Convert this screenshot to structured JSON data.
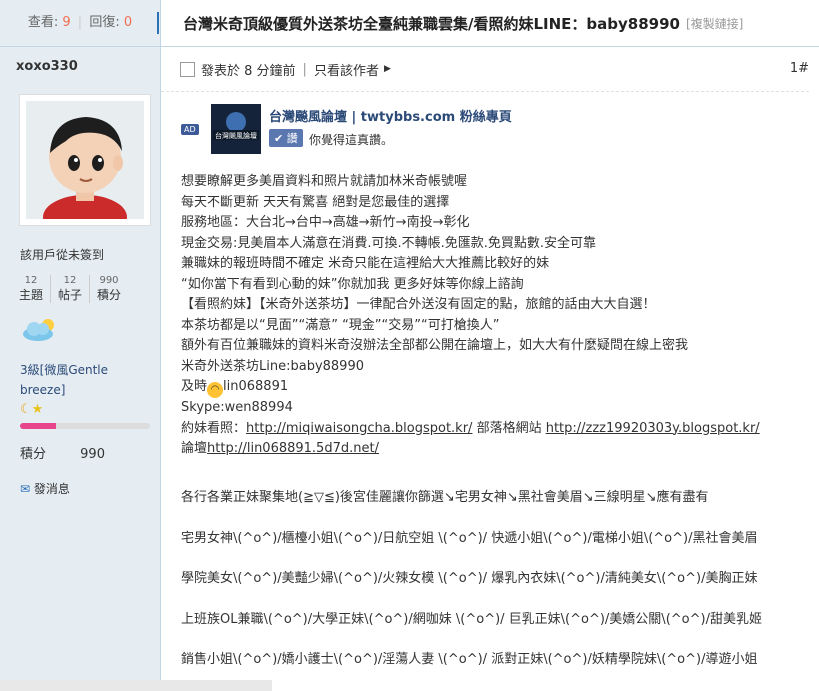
{
  "stats": {
    "views_label": "查看:",
    "views": "9",
    "replies_label": "回復:",
    "replies": "0"
  },
  "user": {
    "name": "xoxo330",
    "signin": "該用戶從未簽到",
    "counts": [
      {
        "value": "12",
        "label": "主題"
      },
      {
        "value": "12",
        "label": "帖子"
      },
      {
        "value": "990",
        "label": "積分"
      }
    ],
    "level": "3級[微風Gentle breeze]",
    "progress": 0.28,
    "score_label": "積分",
    "score": "990",
    "message": "發消息"
  },
  "thread": {
    "title": "台灣米奇頂級優質外送茶坊全臺純兼職雲集/看照約妹LINE：baby88990",
    "copy_link": "[複製鏈接]"
  },
  "post": {
    "posted": "發表於 8 分鐘前",
    "only_author": "只看該作者",
    "floor": "1#"
  },
  "fanpage": {
    "ad": "AD",
    "logo_text": "台灣飈風論壇",
    "name": "台灣飈風論壇 | twtybbs.com 粉絲專頁",
    "like": "讚",
    "text": "你覺得這真讚。"
  },
  "content": {
    "lines": [
      "想要瞭解更多美眉資料和照片就請加林米奇帳號喔",
      "每天不斷更新 天天有驚喜 絕對是您最佳的選擇",
      "服務地區：大台北→台中→高雄→新竹→南投→彰化",
      "現金交易:見美眉本人滿意在消費.可換.不轉帳.免匯款.免買點數.安全可靠",
      "兼職妹的報班時間不確定 米奇只能在這裡給大大推薦比較好的妹",
      "“如你當下有看到心動的妹”你就加我 更多好妹等你線上諮詢",
      "【看照約妹】【米奇外送茶坊】一律配合外送沒有固定的點，旅館的話由大大自選！",
      "本茶坊都是以“見面”“滿意” “現金”“交易”“可打槍換人”",
      "額外有百位兼職妹的資料米奇沒辦法全部都公開在論壇上，如大大有什麼疑問在線上密我",
      "米奇外送茶坊Line:baby88990"
    ],
    "line_prefix": "及時",
    "line_id": "lin068891",
    "skype": "Skype:wen88994",
    "photo_label": "約妹看照：",
    "photo_url1": "http://miqiwaisongcha.blogspot.kr/",
    "photo_mid": " 部落格網站 ",
    "photo_url2": "http://zzz19920303y.blogspot.kr/",
    "forum_label": "論壇",
    "forum_url": "http://lin068891.5d7d.net/",
    "tag_lines": [
      "各行各業正妹聚集地(≧▽≦)後宮佳麗讓你篩選↘宅男女神↘黑社會美眉↘三線明星↘應有盡有",
      "宅男女神\\(^o^)/櫃檯小姐\\(^o^)/日航空姐 \\(^o^)/ 快遞小姐\\(^o^)/電梯小姐\\(^o^)/黑社會美眉",
      "學院美女\\(^o^)/美豔少婦\\(^o^)/火辣女模 \\(^o^)/ 爆乳內衣妹\\(^o^)/清純美女\\(^o^)/美胸正妹",
      "上班族OL兼職\\(^o^)/大學正妹\\(^o^)/網咖妹 \\(^o^)/ 巨乳正妹\\(^o^)/美嬌公關\\(^o^)/甜美乳姬",
      "銷售小姐\\(^o^)/嬌小護士\\(^o^)/淫蕩人妻 \\(^o^)/ 派對正妹\\(^o^)/妖精學院妹\\(^o^)/導遊小姐"
    ]
  }
}
